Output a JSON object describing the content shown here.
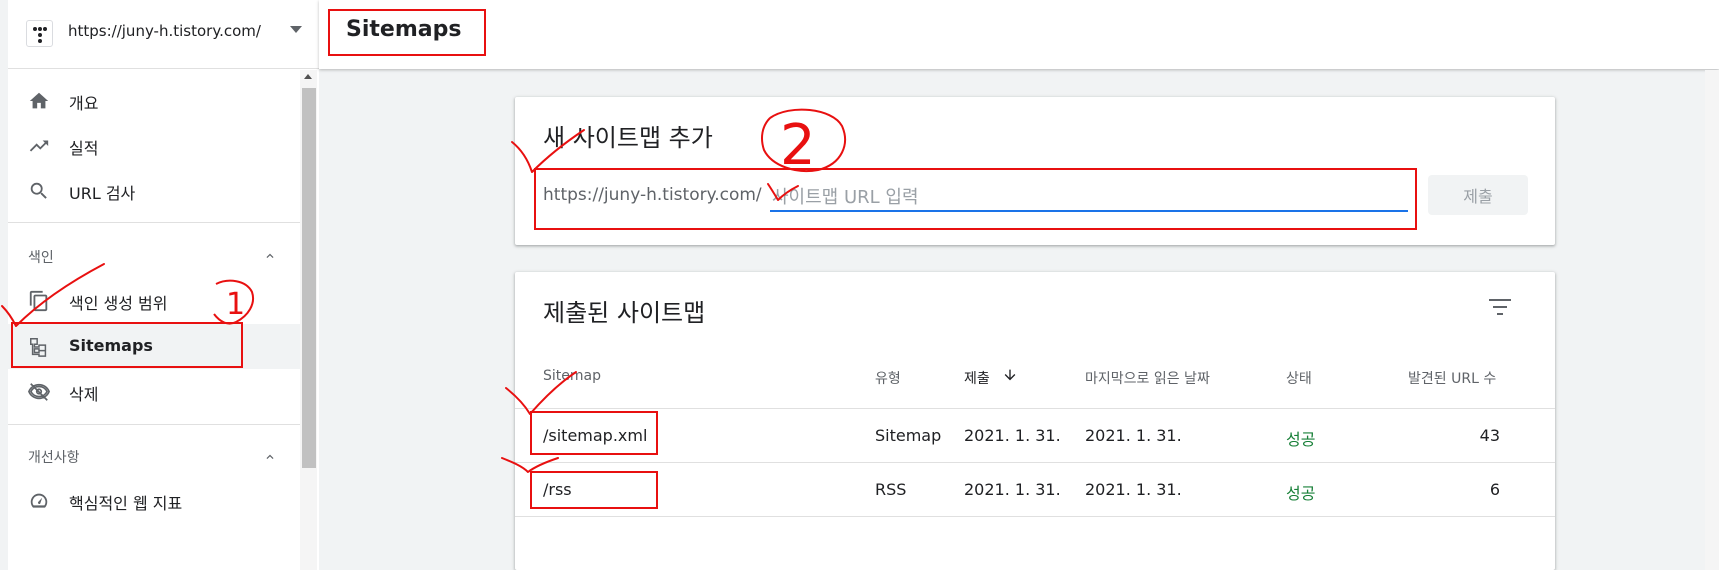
{
  "sidebar": {
    "property_url": "https://juny-h.tistory.com/",
    "nav": [
      {
        "label": "개요",
        "icon": "home-icon"
      },
      {
        "label": "실적",
        "icon": "trending-up-icon"
      },
      {
        "label": "URL 검사",
        "icon": "search-icon"
      }
    ],
    "section_index": {
      "label": "색인",
      "items": [
        {
          "label": "색인 생성 범위",
          "icon": "copy-icon"
        },
        {
          "label": "Sitemaps",
          "icon": "sitemap-icon",
          "active": true
        },
        {
          "label": "삭제",
          "icon": "eye-off-icon"
        }
      ]
    },
    "section_enhance": {
      "label": "개선사항",
      "items": [
        {
          "label": "핵심적인 웹 지표",
          "icon": "gauge-icon"
        }
      ]
    }
  },
  "header": {
    "title": "Sitemaps"
  },
  "add_card": {
    "title": "새 사이트맵 추가",
    "prefix": "https://juny-h.tistory.com/",
    "input_value": "",
    "input_placeholder": "사이트맵 URL 입력",
    "submit_label": "제출"
  },
  "submitted_card": {
    "title": "제출된 사이트맵",
    "columns": {
      "sitemap": "Sitemap",
      "type": "유형",
      "submitted": "제출",
      "last_read": "마지막으로 읽은 날짜",
      "status": "상태",
      "urls": "발견된 URL 수"
    },
    "rows": [
      {
        "sitemap": "/sitemap.xml",
        "type": "Sitemap",
        "submitted": "2021. 1. 31.",
        "last_read": "2021. 1. 31.",
        "status": "성공",
        "urls": "43"
      },
      {
        "sitemap": "/rss",
        "type": "RSS",
        "submitted": "2021. 1. 31.",
        "last_read": "2021. 1. 31.",
        "status": "성공",
        "urls": "6"
      }
    ]
  },
  "annotations": {
    "marker_1": "1",
    "marker_2": "2"
  },
  "colors": {
    "accent": "#1a73e8",
    "success": "#188038",
    "annotation": "#e81010"
  }
}
